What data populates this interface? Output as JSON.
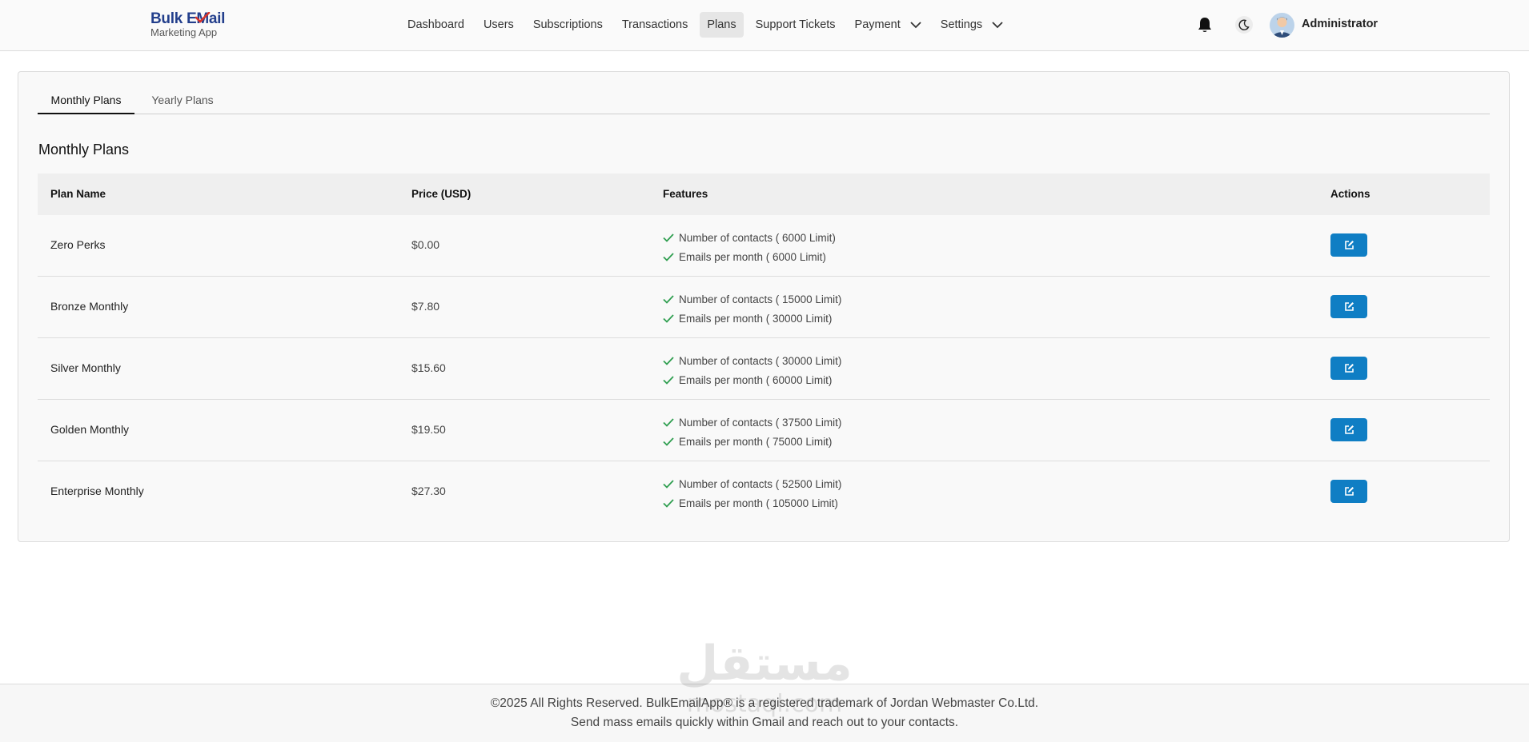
{
  "brand": {
    "logo_line1_a": "Bulk E",
    "logo_line1_b": "ail",
    "logo_line2": "Marketing App"
  },
  "nav": {
    "items": [
      {
        "label": "Dashboard"
      },
      {
        "label": "Users"
      },
      {
        "label": "Subscriptions"
      },
      {
        "label": "Transactions"
      },
      {
        "label": "Plans",
        "active": true
      },
      {
        "label": "Support Tickets"
      },
      {
        "label": "Payment",
        "dropdown": true
      },
      {
        "label": "Settings",
        "dropdown": true
      }
    ]
  },
  "header_right": {
    "notification_icon": "bell-icon",
    "theme_icon": "moon-icon",
    "user_name": "Administrator"
  },
  "tabs": [
    {
      "label": "Monthly Plans",
      "active": true
    },
    {
      "label": "Yearly Plans",
      "active": false
    }
  ],
  "section_title": "Monthly Plans",
  "table": {
    "headers": {
      "name": "Plan Name",
      "price": "Price (USD)",
      "features": "Features",
      "actions": "Actions"
    },
    "rows": [
      {
        "name": "Zero Perks",
        "price": "$0.00",
        "features": [
          "Number of contacts ( 6000 Limit)",
          "Emails per month ( 6000 Limit)"
        ]
      },
      {
        "name": "Bronze Monthly",
        "price": "$7.80",
        "features": [
          "Number of contacts ( 15000 Limit)",
          "Emails per month ( 30000 Limit)"
        ]
      },
      {
        "name": "Silver Monthly",
        "price": "$15.60",
        "features": [
          "Number of contacts ( 30000 Limit)",
          "Emails per month ( 60000 Limit)"
        ]
      },
      {
        "name": "Golden Monthly",
        "price": "$19.50",
        "features": [
          "Number of contacts ( 37500 Limit)",
          "Emails per month ( 75000 Limit)"
        ]
      },
      {
        "name": "Enterprise Monthly",
        "price": "$27.30",
        "features": [
          "Number of contacts ( 52500 Limit)",
          "Emails per month ( 105000 Limit)"
        ]
      }
    ]
  },
  "footer": {
    "line1": "©2025 All Rights Reserved. BulkEmailApp® is a registered trademark of Jordan Webmaster Co.Ltd.",
    "line2": "Send mass emails quickly within Gmail and reach out to your contacts."
  },
  "watermark": {
    "text_ar": "مستقل",
    "text_en": "mostaql.com"
  },
  "colors": {
    "primary_button": "#0f7ec4",
    "check_green": "#2e9e4f",
    "logo_blue": "#233f8c",
    "logo_red": "#d9342b"
  }
}
